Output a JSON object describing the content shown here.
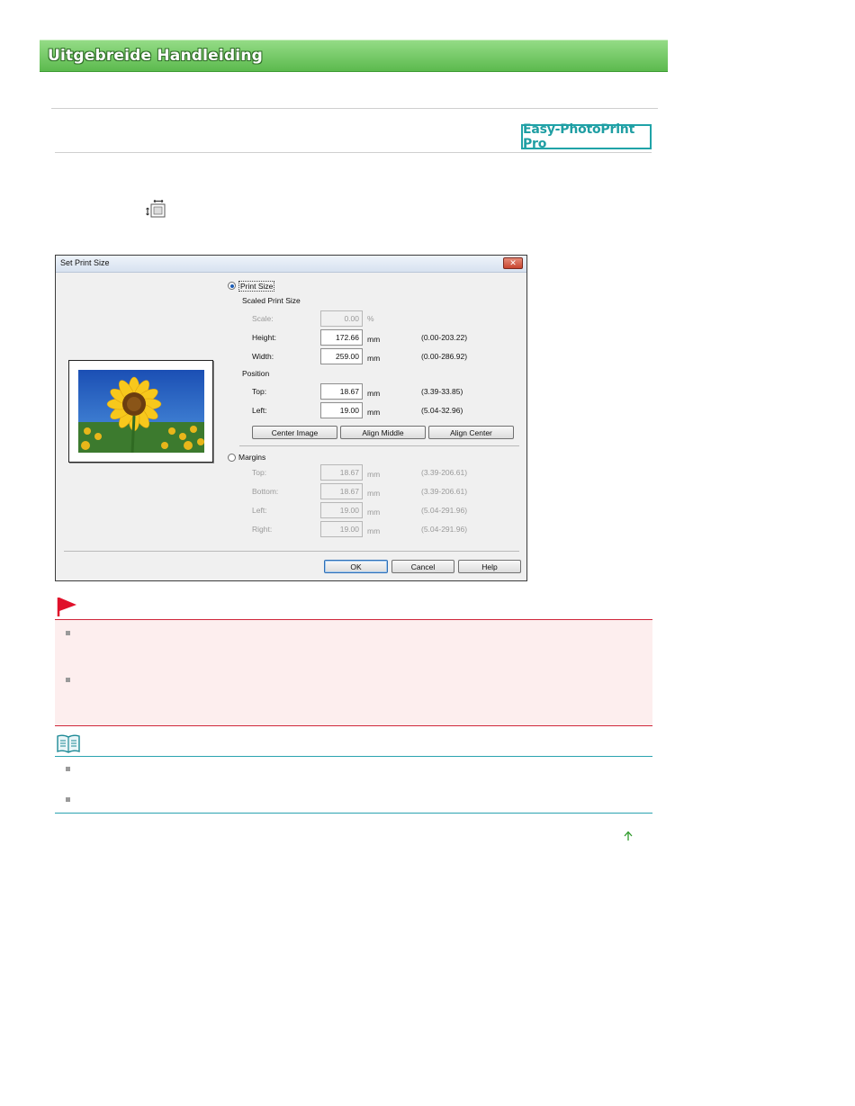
{
  "header": {
    "title": "Uitgebreide Handleiding"
  },
  "product_logo": {
    "text": "Easy-PhotoPrint Pro"
  },
  "dialog": {
    "title": "Set Print Size",
    "print_size_label": "Print Size",
    "scaled_print_size_label": "Scaled Print Size",
    "scale": {
      "label": "Scale:",
      "value": "0.00",
      "unit": "%"
    },
    "height": {
      "label": "Height:",
      "value": "172.66",
      "unit": "mm",
      "range": "(0.00-203.22)"
    },
    "width": {
      "label": "Width:",
      "value": "259.00",
      "unit": "mm",
      "range": "(0.00-286.92)"
    },
    "position_label": "Position",
    "pos_top": {
      "label": "Top:",
      "value": "18.67",
      "unit": "mm",
      "range": "(3.39-33.85)"
    },
    "pos_left": {
      "label": "Left:",
      "value": "19.00",
      "unit": "mm",
      "range": "(5.04-32.96)"
    },
    "center_image_label": "Center Image",
    "align_middle_label": "Align Middle",
    "align_center_label": "Align Center",
    "margins_label": "Margins",
    "m_top": {
      "label": "Top:",
      "value": "18.67",
      "unit": "mm",
      "range": "(3.39-206.61)"
    },
    "m_bottom": {
      "label": "Bottom:",
      "value": "18.67",
      "unit": "mm",
      "range": "(3.39-206.61)"
    },
    "m_left": {
      "label": "Left:",
      "value": "19.00",
      "unit": "mm",
      "range": "(5.04-291.96)"
    },
    "m_right": {
      "label": "Right:",
      "value": "19.00",
      "unit": "mm",
      "range": "(5.04-291.96)"
    },
    "ok_label": "OK",
    "cancel_label": "Cancel",
    "help_label": "Help",
    "selected_option": "print_size"
  },
  "icons": {
    "toolbar": "print-size-icon",
    "important": "red-flag-icon",
    "note": "open-book-icon",
    "top": "up-arrow-icon"
  },
  "colors": {
    "banner_green": "#5cba4e",
    "logo_teal": "#1f9ea3",
    "important_red": "#d0263a",
    "important_bg": "#fdeeee",
    "note_teal": "#2ba3b0"
  }
}
